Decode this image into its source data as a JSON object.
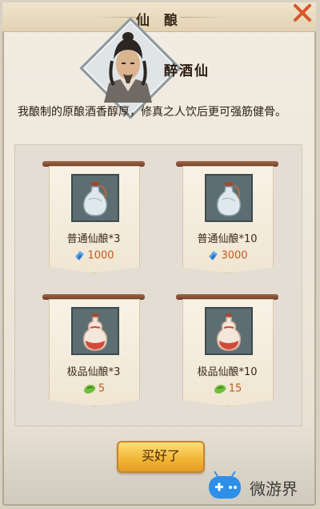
{
  "dialog": {
    "title": "仙 酿",
    "close_icon": "close-x-icon",
    "npc_name": "醉酒仙",
    "description": "我酿制的原酿酒香醇厚，修真之人饮后更可强筋健骨。"
  },
  "items": [
    {
      "name": "普通仙酿*3",
      "price": "1000",
      "currency_icon": "blue-crystal-icon",
      "item_icon": "white-gourd-bottle-icon"
    },
    {
      "name": "普通仙酿*10",
      "price": "3000",
      "currency_icon": "blue-crystal-icon",
      "item_icon": "white-gourd-bottle-icon"
    },
    {
      "name": "极品仙酿*3",
      "price": "5",
      "currency_icon": "green-jade-icon",
      "item_icon": "red-gourd-bottle-icon"
    },
    {
      "name": "极品仙酿*10",
      "price": "15",
      "currency_icon": "green-jade-icon",
      "item_icon": "red-gourd-bottle-icon"
    }
  ],
  "buttons": {
    "confirm": "买好了"
  },
  "watermark": {
    "text": "微游界",
    "icon": "game-controller-logo"
  },
  "colors": {
    "price": "#c6581e",
    "button": "#f1b534",
    "close": "#d9572b"
  }
}
